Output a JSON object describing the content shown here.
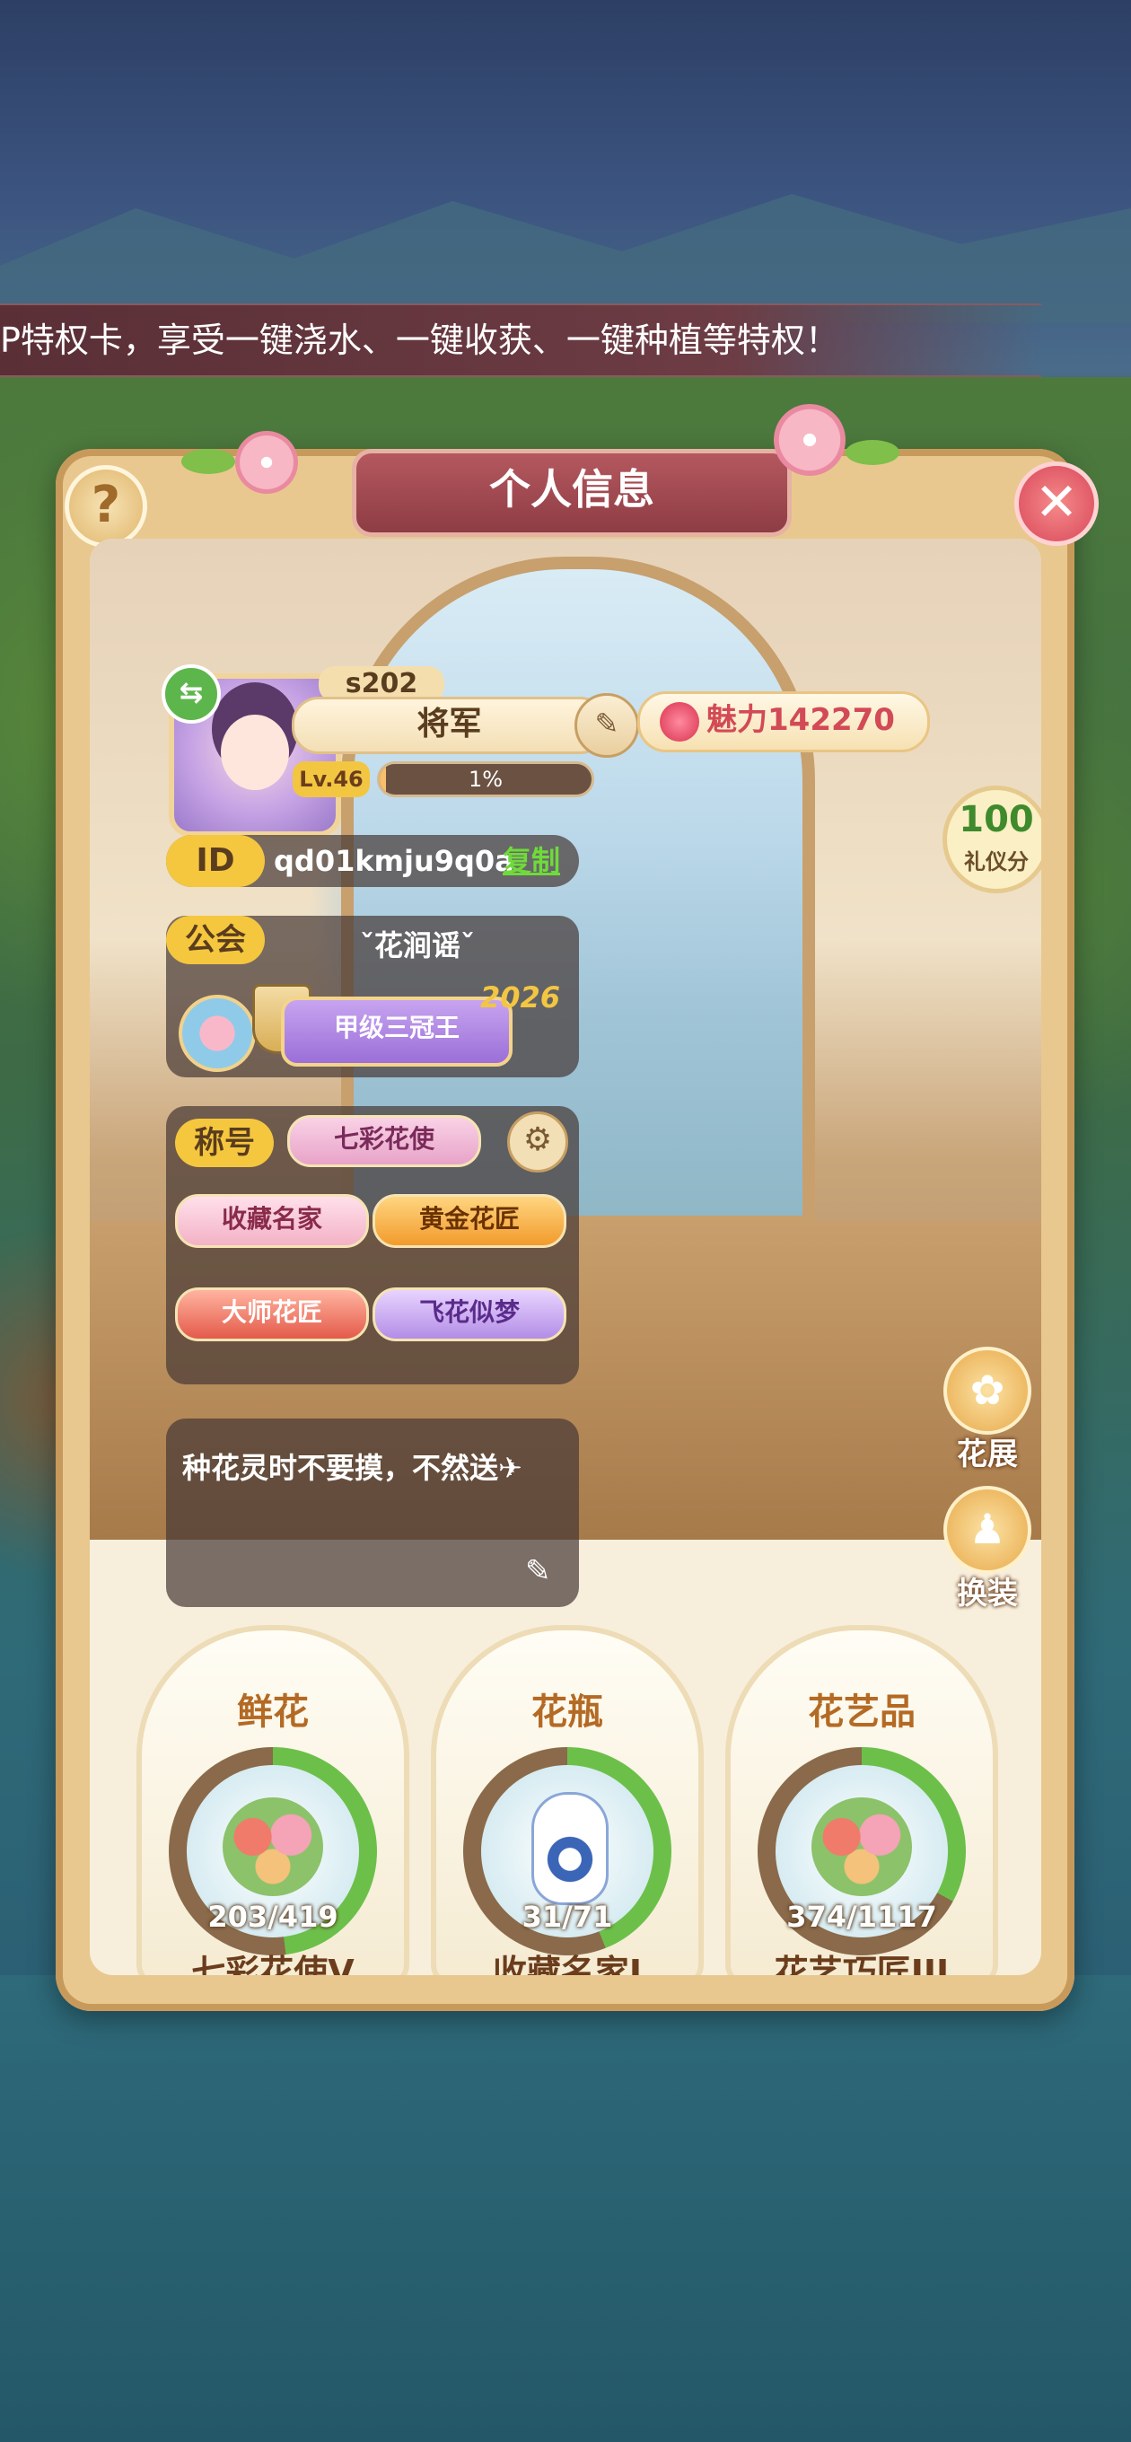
{
  "banner": {
    "text": "P特权卡，享受一键浇水、一键收获、一键种植等特权！"
  },
  "panel": {
    "title": "个人信息",
    "help_icon": "?",
    "close_icon": "✕"
  },
  "profile": {
    "server": "s202",
    "name": "将军",
    "level_label": "Lv.46",
    "exp_percent_text": "1%",
    "exp_fraction": 0.01,
    "charm_text": "魅力142270",
    "etiquette_value": "100",
    "etiquette_label": "礼仪分",
    "id_label": "ID",
    "id_value": "qd01kmju9q0a",
    "copy_label": "复制"
  },
  "guild": {
    "label": "公会",
    "name": "ˇ花涧谣ˇ",
    "badge": "甲级三冠王",
    "year": "2026"
  },
  "titles": {
    "label": "称号",
    "current": "七彩花使",
    "medals": [
      "收藏名家",
      "黄金花匠",
      "大师花匠",
      "飞花似梦"
    ]
  },
  "signature": {
    "text": "种花灵时不要摸，不然送✈"
  },
  "side_buttons": {
    "exhibit": "花展",
    "dress": "换装"
  },
  "collections": [
    {
      "title": "鲜花",
      "count": "203/419",
      "rank": "七彩花使V",
      "progress": 0.48,
      "ring_color": "#6cc04a"
    },
    {
      "title": "花瓶",
      "count": "31/71",
      "rank": "收藏名家I",
      "progress": 0.44,
      "ring_color": "#6cc04a"
    },
    {
      "title": "花艺品",
      "count": "374/1117",
      "rank": "花艺巧匠III",
      "progress": 0.33,
      "ring_color": "#6cc04a"
    }
  ]
}
